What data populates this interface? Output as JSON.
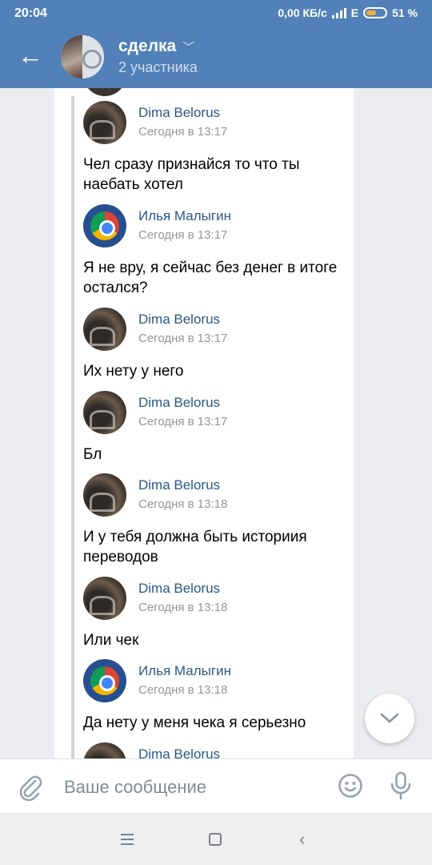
{
  "status_bar": {
    "time": "20:04",
    "network_speed": "0,00 КБ/с",
    "network_type": "E",
    "battery": "51 %"
  },
  "header": {
    "title": "сделка",
    "subtitle": "2 участника"
  },
  "messages": [
    {
      "author": "Dima Belorus",
      "date": "Сегодня в 13:17",
      "avatar": "dima",
      "text": "Чел сразу признайся то что ты наебать хотел"
    },
    {
      "author": "Илья Малыгин",
      "date": "Сегодня в 13:17",
      "avatar": "ilya",
      "text": "Я не вру, я сейчас без денег в итоге остался?"
    },
    {
      "author": "Dima Belorus",
      "date": "Сегодня в 13:17",
      "avatar": "dima",
      "text": "Их нету у него"
    },
    {
      "author": "Dima Belorus",
      "date": "Сегодня в 13:17",
      "avatar": "dima",
      "text": "Бл"
    },
    {
      "author": "Dima Belorus",
      "date": "Сегодня в 13:18",
      "avatar": "dima",
      "text": "И у тебя должна быть историия переводов"
    },
    {
      "author": "Dima Belorus",
      "date": "Сегодня в 13:18",
      "avatar": "dima",
      "text": "Или чек"
    },
    {
      "author": "Илья Малыгин",
      "date": "Сегодня в 13:18",
      "avatar": "ilya",
      "text": "Да нету у меня чека я серьезно"
    },
    {
      "author": "Dima Belorus",
      "avatar": "dima"
    }
  ],
  "composer": {
    "placeholder": "Ваше сообщение"
  },
  "icons": {
    "back": "arrow-left-icon",
    "dropdown": "chevron-down-icon",
    "scroll": "chevron-down-icon",
    "attach": "paperclip-icon",
    "emoji": "smile-icon",
    "voice": "microphone-icon"
  },
  "colors": {
    "header": "#5181b8",
    "author": "#2a5885",
    "date": "#939699",
    "background": "#ebedf0"
  }
}
